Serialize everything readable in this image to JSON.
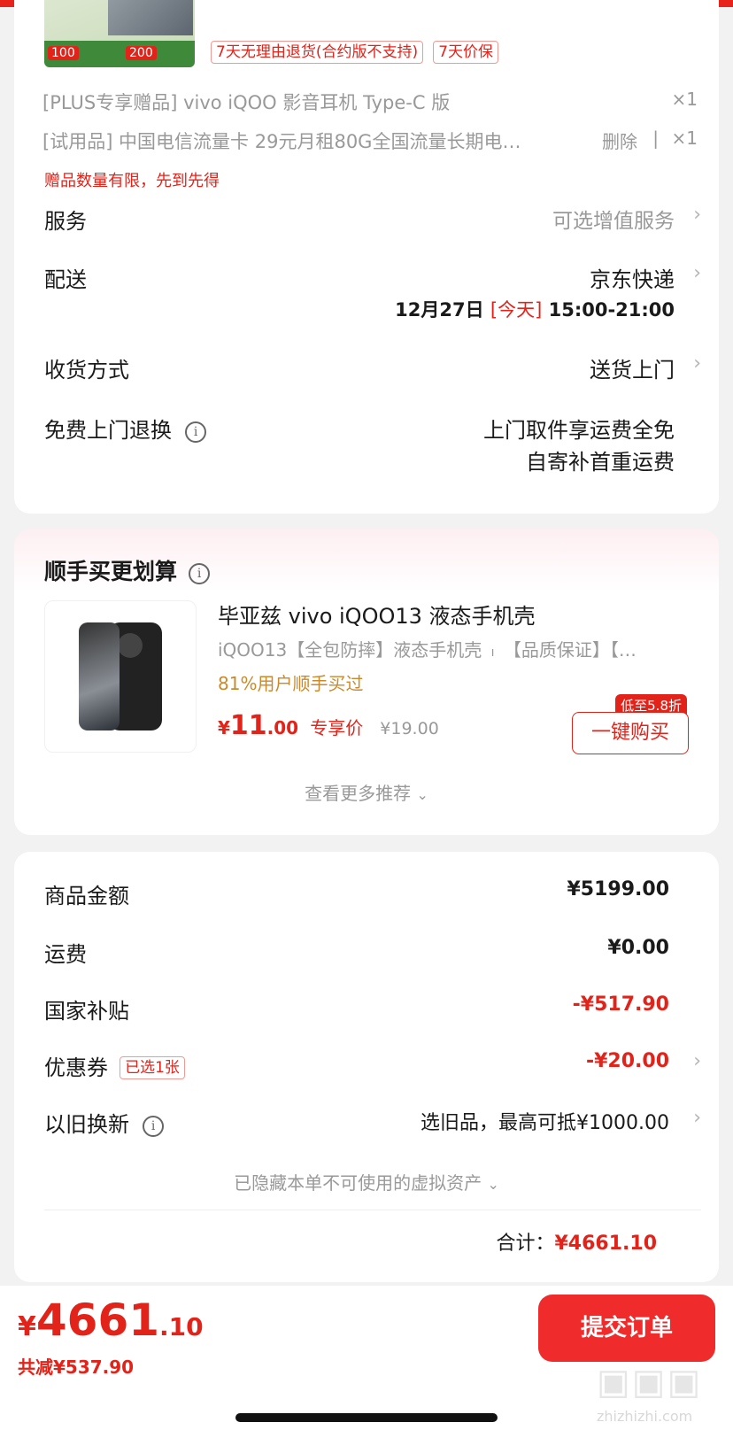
{
  "colors": {
    "accent": "#e2231a",
    "brand_bar": "#e8231b",
    "gift_orange": "#c98a2c",
    "submit_bg": "#ef2b2b"
  },
  "product_top": {
    "promo_image_labels": [
      "100",
      "200"
    ],
    "service_tags": [
      "7天无理由退货(合约版不支持)",
      "7天价保"
    ]
  },
  "gifts": [
    {
      "label": "[PLUS专享赠品] vivo iQOO 影音耳机 Type-C 版",
      "qty": "×1"
    },
    {
      "label": "[试用品] 中国电信流量卡 29元月租80G全国流量长期电…",
      "action": "删除",
      "qty": "×1"
    }
  ],
  "gift_notice": "赠品数量有限，先到先得",
  "rows": {
    "service": {
      "label": "服务",
      "value": "可选增值服务"
    },
    "delivery": {
      "label": "配送",
      "value": "京东快递",
      "date": "12月27日",
      "today": "[今天]",
      "time": "15:00-21:00"
    },
    "receive": {
      "label": "收货方式",
      "value": "送货上门"
    },
    "return": {
      "label": "免费上门退换",
      "line1": "上门取件享运费全免",
      "line2": "自寄补首重运费"
    }
  },
  "recommend": {
    "title": "顺手买更划算",
    "item": {
      "name": "毕亚兹 vivo iQOO13 液态手机壳",
      "desc_left": "iQOO13【全包防摔】液态手机壳",
      "desc_right": "【品质保证】【…",
      "bought": "81%用户顺手买过",
      "currency": "¥",
      "price_int": "11",
      "price_dec": ".00",
      "price_tag": "专享价",
      "orig_price": "¥19.00",
      "discount_badge": "低至5.8折",
      "buy_label": "一键购买"
    },
    "more_label": "查看更多推荐"
  },
  "summary": {
    "items": [
      {
        "label": "商品金额",
        "value": "¥5199.00"
      },
      {
        "label": "运费",
        "value": "¥0.00"
      },
      {
        "label": "国家补贴",
        "value": "-¥517.90"
      },
      {
        "label": "优惠券",
        "badge": "已选1张",
        "value": "-¥20.00"
      },
      {
        "label": "以旧换新",
        "value": "选旧品，最高可抵¥1000.00"
      }
    ],
    "hidden_assets": "已隐藏本单不可使用的虚拟资产",
    "total_label": "合计：",
    "total_value": "¥4661.10"
  },
  "footer": {
    "currency": "¥",
    "price_int": "4661",
    "price_dec": ".10",
    "saved": "共减¥537.90",
    "submit_label": "提交订单",
    "watermark": "zhizhizhi.com"
  }
}
